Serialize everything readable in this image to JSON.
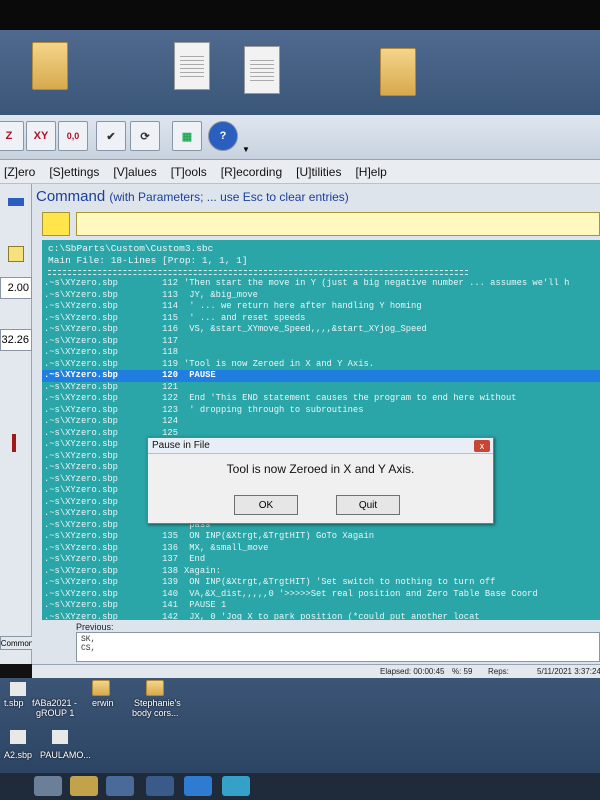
{
  "desktop": {
    "bottom_icons": [
      {
        "label": "t.sbp"
      },
      {
        "label": "fABa2021 -"
      },
      {
        "label": "gROUP 1"
      },
      {
        "label": "erwin"
      },
      {
        "label": "Stephanie's"
      },
      {
        "label": "body cors..."
      },
      {
        "label": "A2.sbp"
      },
      {
        "label": "PAULAMO..."
      }
    ]
  },
  "toolbar": {
    "xy_label": "XY",
    "zero_label": "0,0",
    "z_label": "Z"
  },
  "menu": {
    "items": [
      "[Z]ero",
      "[S]ettings",
      "[V]alues",
      "[T]ools",
      "[R]ecording",
      "[U]tilities",
      "[H]elp"
    ]
  },
  "left_values": {
    "v1": "2.00",
    "v2": "32.26"
  },
  "command": {
    "title": "Command",
    "subtitle": "(with Parameters;  ... use Esc to clear entries)"
  },
  "file": {
    "path": "c:\\SbParts\\Custom\\Custom3.sbc",
    "main_file": "Main File:  18-Lines [Prop: 1, 1, 1]"
  },
  "code_lines": [
    {
      "file": ".~s\\XYzero.sbp",
      "num": "112",
      "text": "'Then start the move in Y (just a big negative number ... assumes we'll h"
    },
    {
      "file": ".~s\\XYzero.sbp",
      "num": "113",
      "text": "   JY, &big_move"
    },
    {
      "file": ".~s\\XYzero.sbp",
      "num": "114",
      "text": "  ' ... we return here after handling Y homing"
    },
    {
      "file": ".~s\\XYzero.sbp",
      "num": "115",
      "text": "  ' ... and reset speeds"
    },
    {
      "file": ".~s\\XYzero.sbp",
      "num": "116",
      "text": "   VS, &start_XYmove_Speed,,,,&start_XYjog_Speed"
    },
    {
      "file": ".~s\\XYzero.sbp",
      "num": "117",
      "text": ""
    },
    {
      "file": ".~s\\XYzero.sbp",
      "num": "118",
      "text": ""
    },
    {
      "file": ".~s\\XYzero.sbp",
      "num": "119",
      "text": "'Tool is now Zeroed in X and Y Axis."
    },
    {
      "file": ".~s\\XYzero.sbp",
      "num": "120",
      "text": "   PAUSE"
    },
    {
      "file": ".~s\\XYzero.sbp",
      "num": "121",
      "text": ""
    },
    {
      "file": ".~s\\XYzero.sbp",
      "num": "122",
      "text": "   End      'This END statement causes the program to end here without"
    },
    {
      "file": ".~s\\XYzero.sbp",
      "num": "123",
      "text": "              ' dropping through to subroutines"
    },
    {
      "file": ".~s\\XYzero.sbp",
      "num": "124",
      "text": ""
    },
    {
      "file": ".~s\\XYzero.sbp",
      "num": "125",
      "text": ""
    },
    {
      "file": ".~s\\XYzero.sbp",
      "num": "",
      "text": ""
    },
    {
      "file": ".~s\\XYzero.sbp",
      "num": "",
      "text": ""
    },
    {
      "file": ".~s\\XYzero.sbp",
      "num": "",
      "text": ""
    },
    {
      "file": ".~s\\XYzero.sbp",
      "num": "",
      "text": "                                                                    turn off"
    },
    {
      "file": ".~s\\XYzero.sbp",
      "num": "",
      "text": "                                                                    ging ..."
    },
    {
      "file": ".~s\\XYzero.sbp",
      "num": "",
      "text": ""
    },
    {
      "file": ".~s\\XYzero.sbp",
      "num": "",
      "text": ""
    },
    {
      "file": ".~s\\XYzero.sbp",
      "num": "",
      "text": "                                                                      pass"
    },
    {
      "file": ".~s\\XYzero.sbp",
      "num": "135",
      "text": "   ON INP(&Xtrgt,&TrgtHIT) GoTo Xagain"
    },
    {
      "file": ".~s\\XYzero.sbp",
      "num": "136",
      "text": "   MX, &small_move"
    },
    {
      "file": ".~s\\XYzero.sbp",
      "num": "137",
      "text": "   End"
    },
    {
      "file": ".~s\\XYzero.sbp",
      "num": "138",
      "text": "Xagain:"
    },
    {
      "file": ".~s\\XYzero.sbp",
      "num": "139",
      "text": "   ON INP(&Xtrgt,&TrgtHIT)      'Set switch to nothing to turn off"
    },
    {
      "file": ".~s\\XYzero.sbp",
      "num": "140",
      "text": "   VA,&X_dist,,,,,0         '>>>>>Set real position and Zero Table Base Coord"
    },
    {
      "file": ".~s\\XYzero.sbp",
      "num": "141",
      "text": "   PAUSE 1"
    },
    {
      "file": ".~s\\XYzero.sbp",
      "num": "142",
      "text": "   JX, 0                    'Jog X to park position (*could put another locat"
    },
    {
      "file": ".~s\\XYzero.sbp",
      "num": "143",
      "text": "'X Axis now zeroed ..."
    },
    {
      "file": ".~s\\XYzero.sbp",
      "num": "144",
      "text": "   PAUSE 1"
    }
  ],
  "previous": {
    "label": "Previous:",
    "lines": [
      "SK,",
      "CS,"
    ]
  },
  "common_tab": "Common",
  "status": {
    "elapsed": "Elapsed: 00:00:45",
    "percent": "%: 59",
    "reps": "Reps:",
    "datetime": "5/11/2021  3:37:24"
  },
  "dialog": {
    "title": "Pause in File",
    "close": "x",
    "message": "Tool is now Zeroed in X and Y Axis.",
    "ok": "OK",
    "quit": "Quit"
  },
  "colors": {
    "editor_bg": "#2aa5a8",
    "highlight": "#1f7ee0",
    "command_title": "#1d3f9a",
    "yellow": "#ffe54a"
  }
}
